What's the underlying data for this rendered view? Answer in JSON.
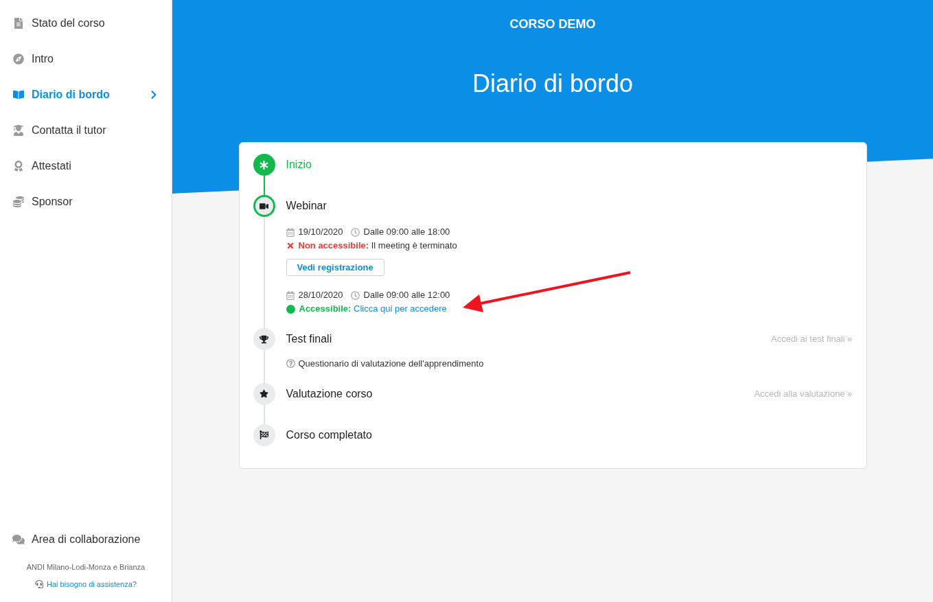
{
  "sidebar": {
    "items": [
      {
        "label": "Stato del corso",
        "selected": false
      },
      {
        "label": "Intro",
        "selected": false
      },
      {
        "label": "Diario di bordo",
        "selected": true
      },
      {
        "label": "Contatta il tutor",
        "selected": false
      },
      {
        "label": "Attestati",
        "selected": false
      },
      {
        "label": "Sponsor",
        "selected": false
      }
    ],
    "collaboration": "Area di collaborazione",
    "organization": "ANDI Milano-Lodi-Monza e Brianza",
    "help_link": "Hai bisogno di assistenza?"
  },
  "header": {
    "course": "CORSO DEMO",
    "title": "Diario di bordo"
  },
  "timeline": [
    {
      "kind": "start",
      "title": "Inizio",
      "completed": true,
      "current": false
    },
    {
      "kind": "webinar",
      "title": "Webinar",
      "completed": false,
      "current": true,
      "sessions": [
        {
          "date": "19/10/2020",
          "time": "Dalle 09:00 alle 18:00",
          "accessible": false,
          "status_label": "Non accessibile:",
          "status_text": "Il meeting è terminato",
          "button": "Vedi registrazione"
        },
        {
          "date": "28/10/2020",
          "time": "Dalle 09:00 alle 12:00",
          "accessible": true,
          "status_label": "Accessibile:",
          "status_text": "Clicca qui per accedere"
        }
      ]
    },
    {
      "kind": "test",
      "title": "Test finali",
      "completed": false,
      "current": false,
      "link": "Accedi ai test finali »",
      "note": "Questionario di valutazione dell'apprendimento"
    },
    {
      "kind": "rating",
      "title": "Valutazione corso",
      "completed": false,
      "current": false,
      "link": "Accedi alla valutazione »"
    },
    {
      "kind": "finish",
      "title": "Corso completato",
      "completed": false,
      "current": false
    }
  ],
  "annotation": {
    "kind": "arrow"
  }
}
